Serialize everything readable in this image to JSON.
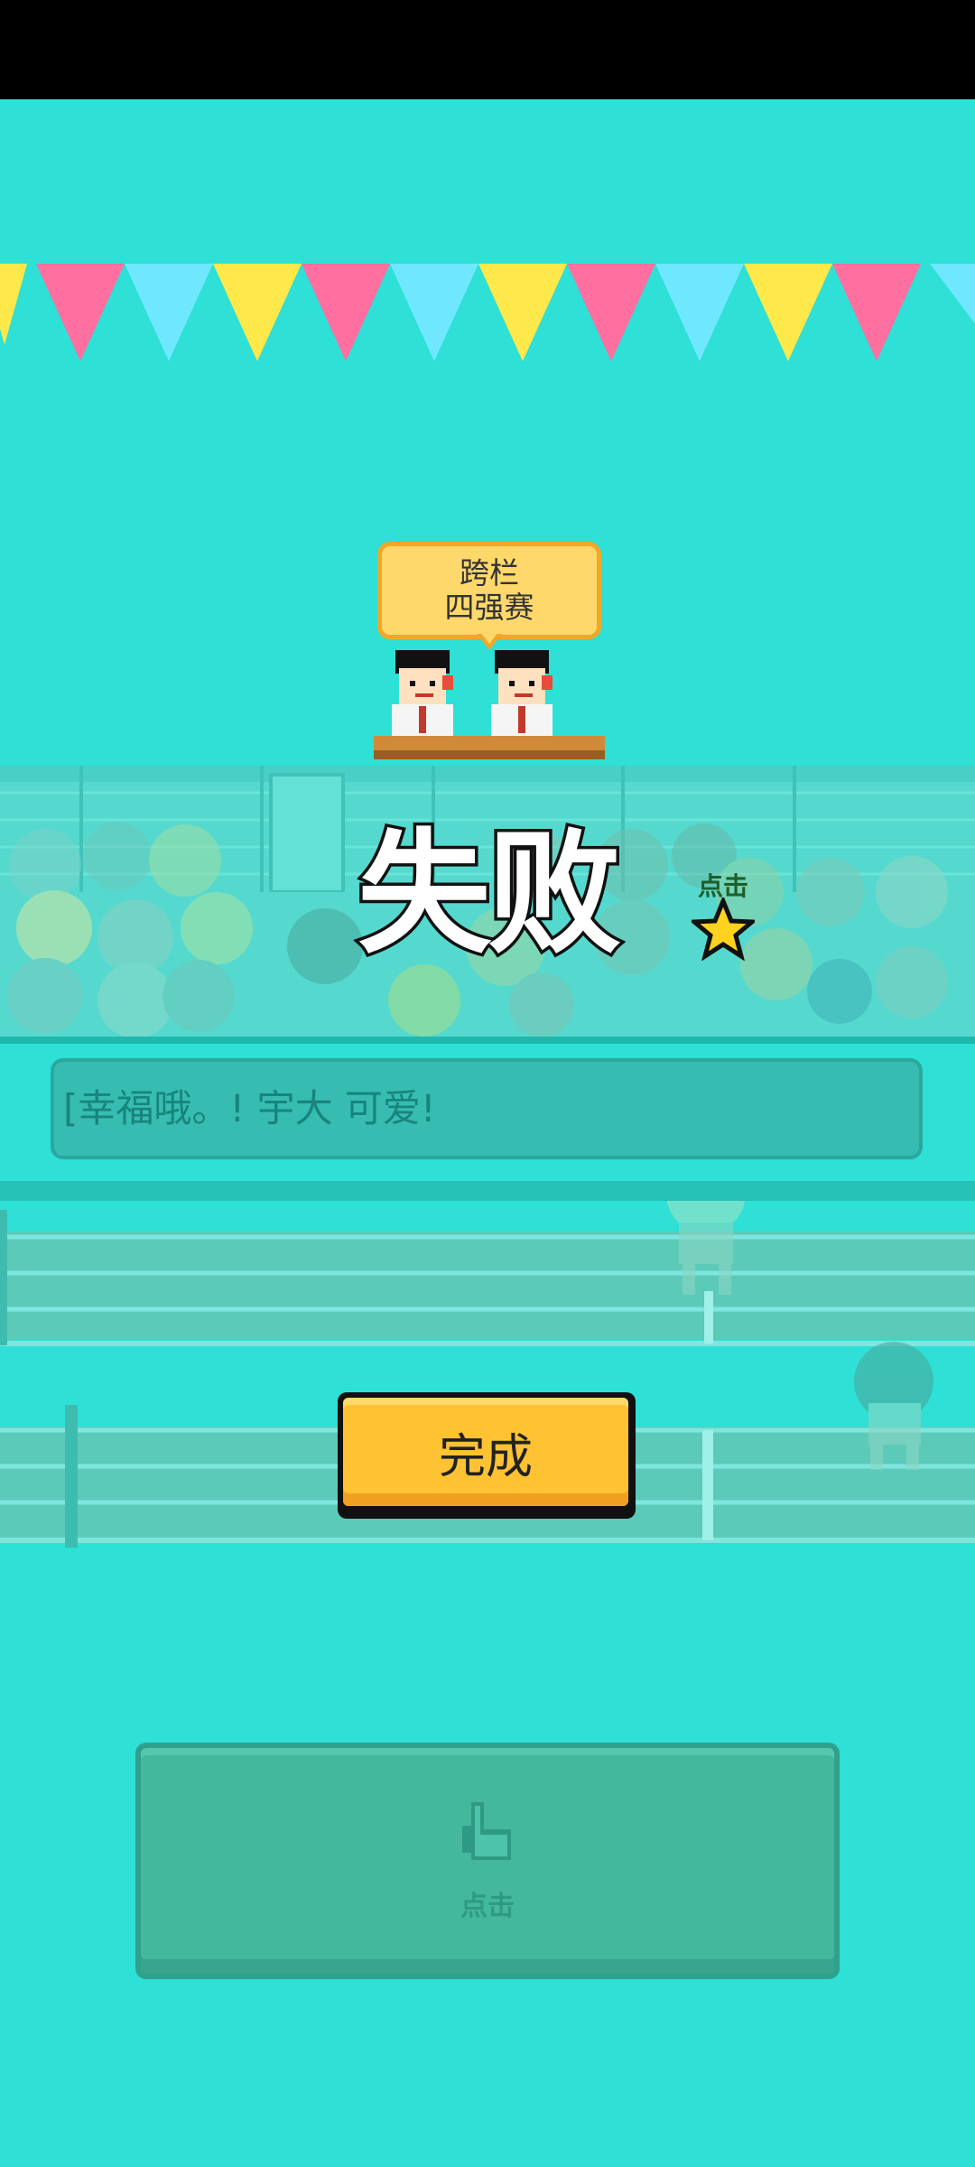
{
  "event": {
    "line1": "跨栏",
    "line2": "四强赛"
  },
  "result": {
    "title": "失败"
  },
  "star_hint": {
    "label": "点击",
    "icon": "star-icon"
  },
  "ticker": {
    "text": "[幸福哦。! 宇大 可爱!"
  },
  "done_button": {
    "label": "完成"
  },
  "tap_pad": {
    "label": "点击",
    "icon": "pointing-hand-icon"
  },
  "colors": {
    "background": "#2ee0d6",
    "button_yellow": "#ffc233",
    "tap_pad": "#44b89d",
    "flag_pink": "#ff6fa0",
    "flag_blue": "#6fe8ff",
    "flag_yellow": "#ffe84a"
  }
}
